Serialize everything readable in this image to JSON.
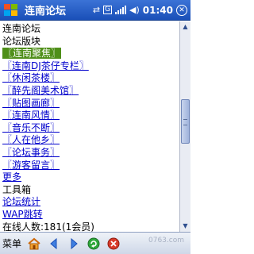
{
  "title_bar": {
    "title": "连南论坛",
    "clock": "01:40",
    "status_letter": "G"
  },
  "content": {
    "lines": [
      {
        "text": "连南论坛",
        "link": false,
        "highlight": false
      },
      {
        "text": "论坛版块",
        "link": false,
        "highlight": false
      },
      {
        "text": "〖连南聚焦〗",
        "link": true,
        "highlight": true
      },
      {
        "text": "〖连南DJ茶仔专栏〗",
        "link": true,
        "highlight": false
      },
      {
        "text": "〖休闲茶楼〗",
        "link": true,
        "highlight": false
      },
      {
        "text": "〖醉先阁美术馆〗",
        "link": true,
        "highlight": false
      },
      {
        "text": "〖贴图画廊〗",
        "link": true,
        "highlight": false
      },
      {
        "text": "〖连南风情〗",
        "link": true,
        "highlight": false
      },
      {
        "text": "〖音乐不断〗",
        "link": true,
        "highlight": false
      },
      {
        "text": "〖人在他乡〗",
        "link": true,
        "highlight": false
      },
      {
        "text": "〖论坛事务〗",
        "link": true,
        "highlight": false
      },
      {
        "text": "〖游客留言〗",
        "link": true,
        "highlight": false
      },
      {
        "text": "更多",
        "link": true,
        "highlight": false
      },
      {
        "text": "工具箱",
        "link": false,
        "highlight": false
      },
      {
        "text": "论坛统计",
        "link": true,
        "highlight": false
      },
      {
        "text": "WAP跳转",
        "link": true,
        "highlight": false
      },
      {
        "text": "在线人数:181(1会员)",
        "link": false,
        "highlight": false
      }
    ]
  },
  "bottom_bar": {
    "menu_label": "菜单",
    "icons": [
      "home-icon",
      "back-icon",
      "forward-icon",
      "refresh-icon",
      "stop-icon"
    ]
  },
  "watermark": "0763.com",
  "colors": {
    "title_bar": "#1a4fb8",
    "link": "#0000cc",
    "highlight": "#4f8f19"
  }
}
